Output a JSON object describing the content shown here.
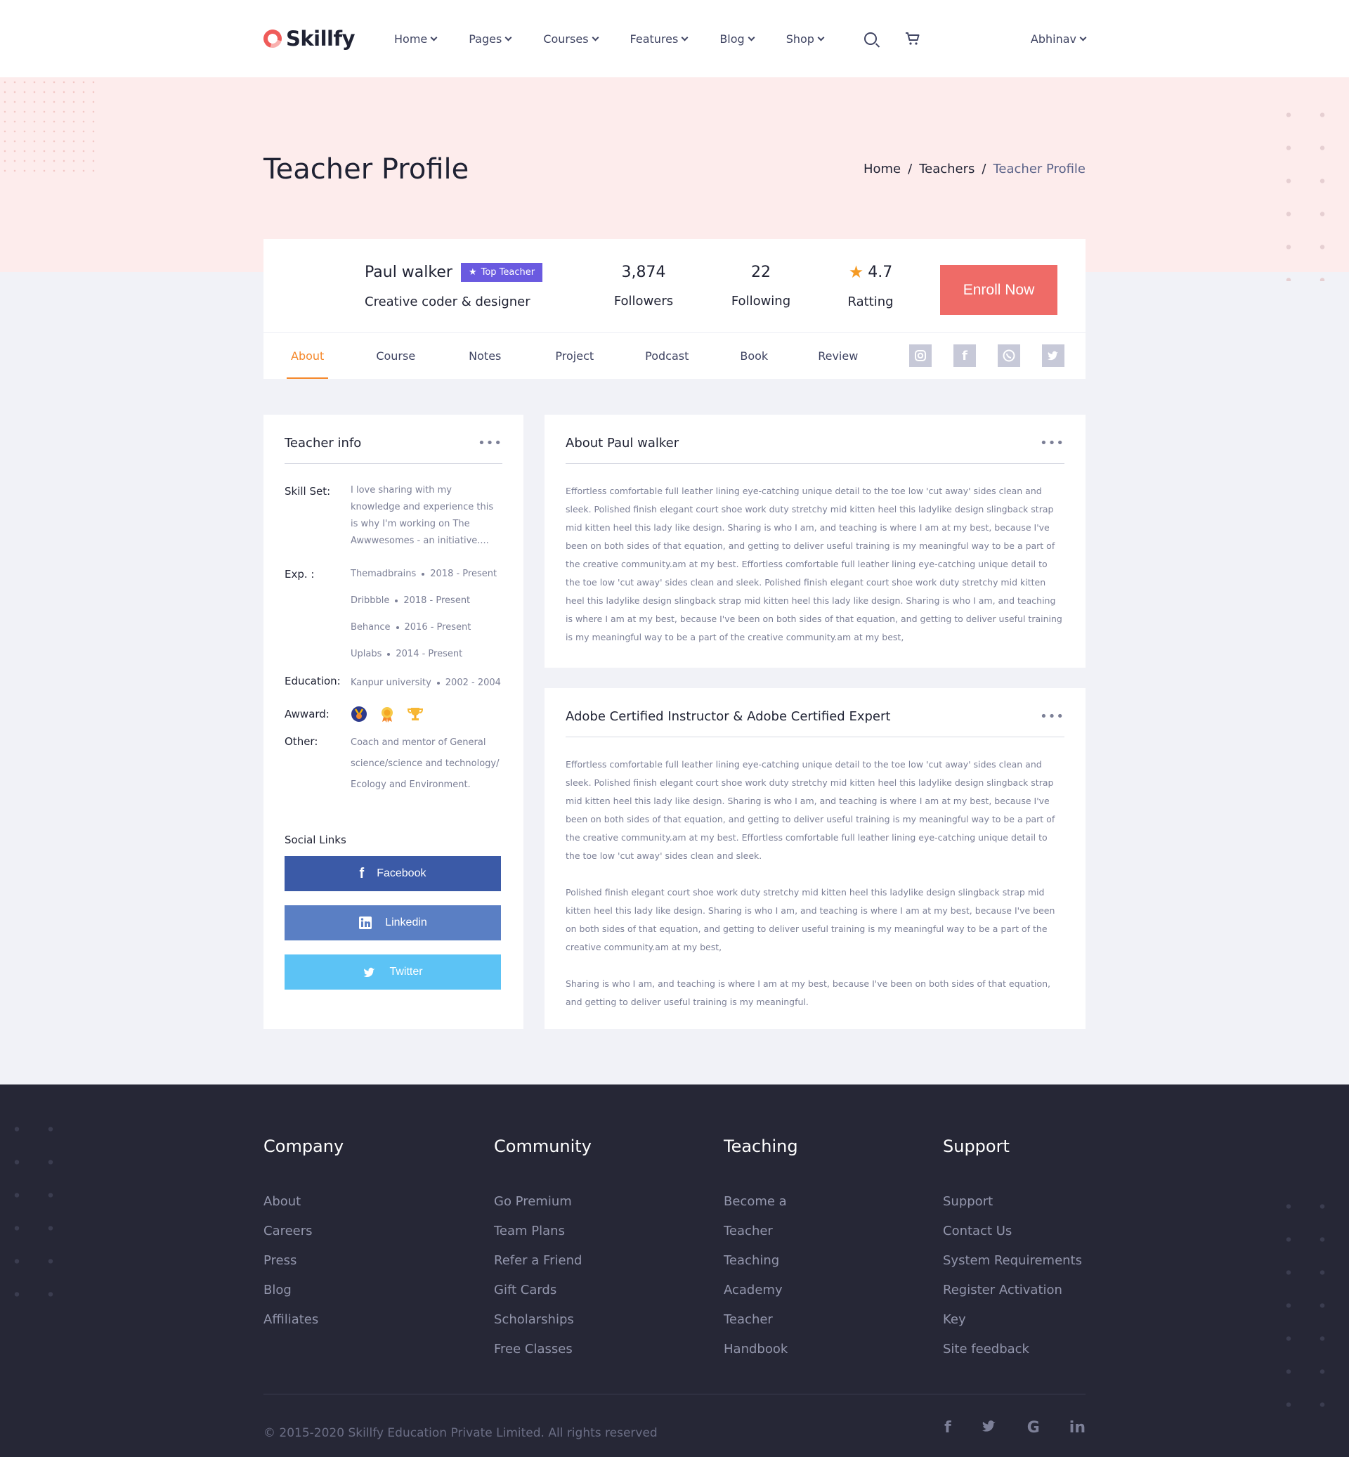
{
  "brand": {
    "name": "Skillfy",
    "accent": "#ef5b59"
  },
  "nav": {
    "items": [
      "Home",
      "Pages",
      "Courses",
      "Features",
      "Blog",
      "Shop"
    ],
    "user": "Abhinav"
  },
  "hero": {
    "title": "Teacher Profile",
    "breadcrumb": [
      "Home",
      "Teachers",
      "Teacher Profile"
    ],
    "separator": "/"
  },
  "profile": {
    "name": "Paul walker",
    "badge": "Top Teacher",
    "subtitle": "Creative coder & designer",
    "stats": [
      {
        "value": "3,874",
        "label": "Followers"
      },
      {
        "value": "22",
        "label": "Following"
      },
      {
        "value": "4.7",
        "label": "Ratting"
      }
    ],
    "enroll": "Enroll Now",
    "tabs": [
      "About",
      "Course",
      "Notes",
      "Project",
      "Podcast",
      "Book",
      "Review"
    ],
    "active_tab": "About",
    "social_icons": [
      "instagram-icon",
      "facebook-icon",
      "whatsapp-icon",
      "twitter-icon"
    ]
  },
  "teacher_info": {
    "title": "Teacher info",
    "skill_label": "Skill Set:",
    "skill_text": "I love sharing with my knowledge and experience this is why I'm working on The Awwwesomes - an initiative....",
    "exp_label": "Exp. :",
    "experience": [
      {
        "company": "Themadbrains",
        "period": "2018 - Present"
      },
      {
        "company": "Dribbble",
        "period": "2018 - Present"
      },
      {
        "company": "Behance",
        "period": "2016 - Present"
      },
      {
        "company": "Uplabs",
        "period": "2014 - Present"
      }
    ],
    "edu_label": "Education:",
    "education": {
      "school": "Kanpur university",
      "period": "2002 - 2004"
    },
    "award_label": "Awward:",
    "award_icons": [
      "medal-icon",
      "badge-icon",
      "trophy-icon"
    ],
    "other_label": "Other:",
    "other_text": "Coach and mentor of General science/science and technology/ Ecology and Environment.",
    "social_title": "Social Links",
    "social_buttons": [
      "Facebook",
      "Linkedin",
      "Twitter"
    ]
  },
  "about": {
    "title": "About Paul walker",
    "text": "Effortless comfortable full leather lining eye-catching unique detail to the toe low 'cut away' sides clean and sleek. Polished finish elegant court shoe work duty stretchy mid kitten heel this ladylike design slingback strap mid kitten heel this lady like design. Sharing is who I am, and teaching is where I am at my best, because I've been on both sides of that equation, and getting to deliver useful training is my meaningful way to  be a part of the creative community.am at my best. Effortless comfortable full leather lining eye-catching unique detail to the toe low 'cut away' sides clean and sleek. Polished finish elegant court shoe work duty stretchy mid kitten heel this ladylike design slingback strap mid kitten heel this lady like design. Sharing is who I am, and teaching is where I am at my best, because I've been on both sides of that equation, and getting to deliver useful training is my meaningful way to  be a part of the creative community.am at my best,"
  },
  "certified": {
    "title": "Adobe Certified Instructor & Adobe Certified Expert",
    "paragraphs": [
      "Effortless comfortable full leather lining eye-catching unique detail to the toe low 'cut away' sides clean and sleek. Polished finish elegant court shoe work duty stretchy mid kitten heel this ladylike design slingback strap mid kitten heel this lady like design. Sharing is who I am, and teaching is where I am at my best, because I've been on both sides of that equation, and getting to deliver useful training is my meaningful way to  be a part of the creative community.am at my best. Effortless comfortable full leather lining eye-catching unique detail to the toe low 'cut away' sides clean and sleek.",
      "Polished finish elegant court shoe work duty stretchy mid kitten heel this ladylike design slingback strap mid kitten heel this lady like design. Sharing is who I am, and teaching is where I am at my best, because I've been on both sides of that equation, and getting to deliver useful training is my meaningful way to  be a part of the creative community.am at my best,",
      "Sharing is who I am, and teaching is where I am at my best, because I've been on both sides of that equation, and getting to deliver useful training is my meaningful."
    ]
  },
  "footer": {
    "columns": [
      {
        "title": "Company",
        "links": [
          "About",
          "Careers",
          "Press",
          "Blog",
          "Affiliates"
        ]
      },
      {
        "title": "Community",
        "links": [
          "Go Premium",
          "Team Plans",
          "Refer a Friend",
          "Gift Cards",
          "Scholarships",
          "Free Classes"
        ]
      },
      {
        "title": "Teaching",
        "links": [
          "Become a",
          "Teacher",
          "Teaching",
          "Academy",
          "Teacher",
          "Handbook"
        ]
      },
      {
        "title": "Support",
        "links": [
          "Support",
          "Contact Us",
          "System Requirements",
          "Register Activation",
          "Key",
          "Site feedback"
        ]
      }
    ],
    "copyright": "© 2015-2020 Skillfy Education Private Limited. All rights reserved",
    "social_icons": [
      "facebook-icon",
      "twitter-icon",
      "google-icon",
      "linkedin-icon"
    ]
  }
}
